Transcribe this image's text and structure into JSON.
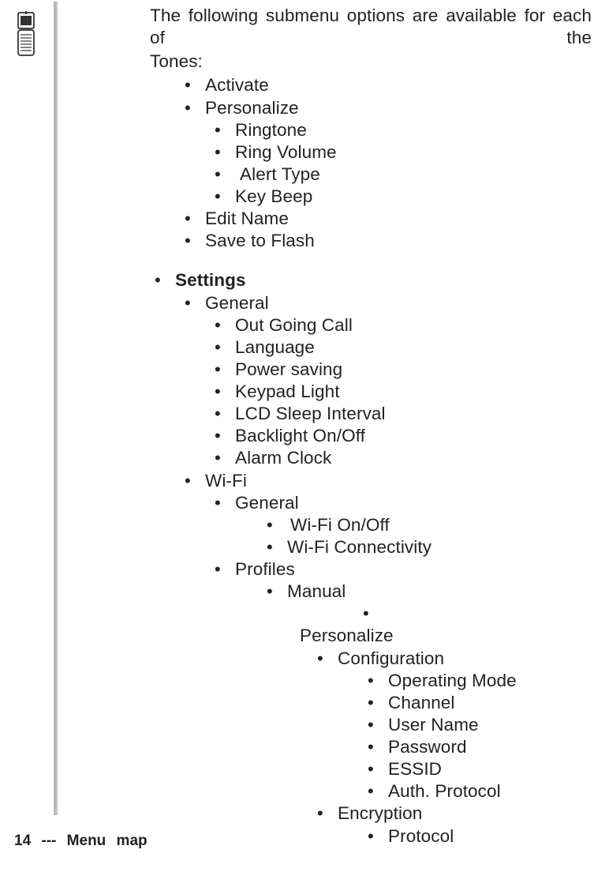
{
  "intro_line1": "The following submenu options are available for each of the",
  "intro_line2": "Tones:",
  "tones_sub": {
    "activate": "Activate",
    "personalize": "Personalize",
    "ringtone": "Ringtone",
    "ring_volume": "Ring Volume",
    "alert_type": "Alert Type",
    "key_beep": "Key Beep",
    "edit_name": "Edit Name",
    "save_flash": "Save to Flash"
  },
  "settings": {
    "heading": "Settings",
    "general": {
      "label": "General",
      "out_call": "Out Going Call",
      "language": "Language",
      "power_saving": "Power saving",
      "keypad_light": "Keypad Light",
      "lcd_sleep": "LCD Sleep Interval",
      "backlight": "Backlight On/Off",
      "alarm": "Alarm Clock"
    },
    "wifi": {
      "label": "Wi-Fi",
      "general": {
        "label": "General",
        "onoff": "Wi-Fi On/Off",
        "conn": "Wi-Fi Connectivity"
      },
      "profiles": {
        "label": "Profiles",
        "manual": {
          "label": "Manual",
          "personalize": "Personalize",
          "configuration": {
            "label": "Configuration",
            "op_mode": "Operating Mode",
            "channel": "Channel",
            "user_name": "User Name",
            "password": "Password",
            "essid": "ESSID",
            "auth": "Auth. Protocol"
          },
          "encryption": {
            "label": "Encryption",
            "protocol": "Protocol"
          }
        }
      }
    }
  },
  "footer": "14   ---   Menu map"
}
